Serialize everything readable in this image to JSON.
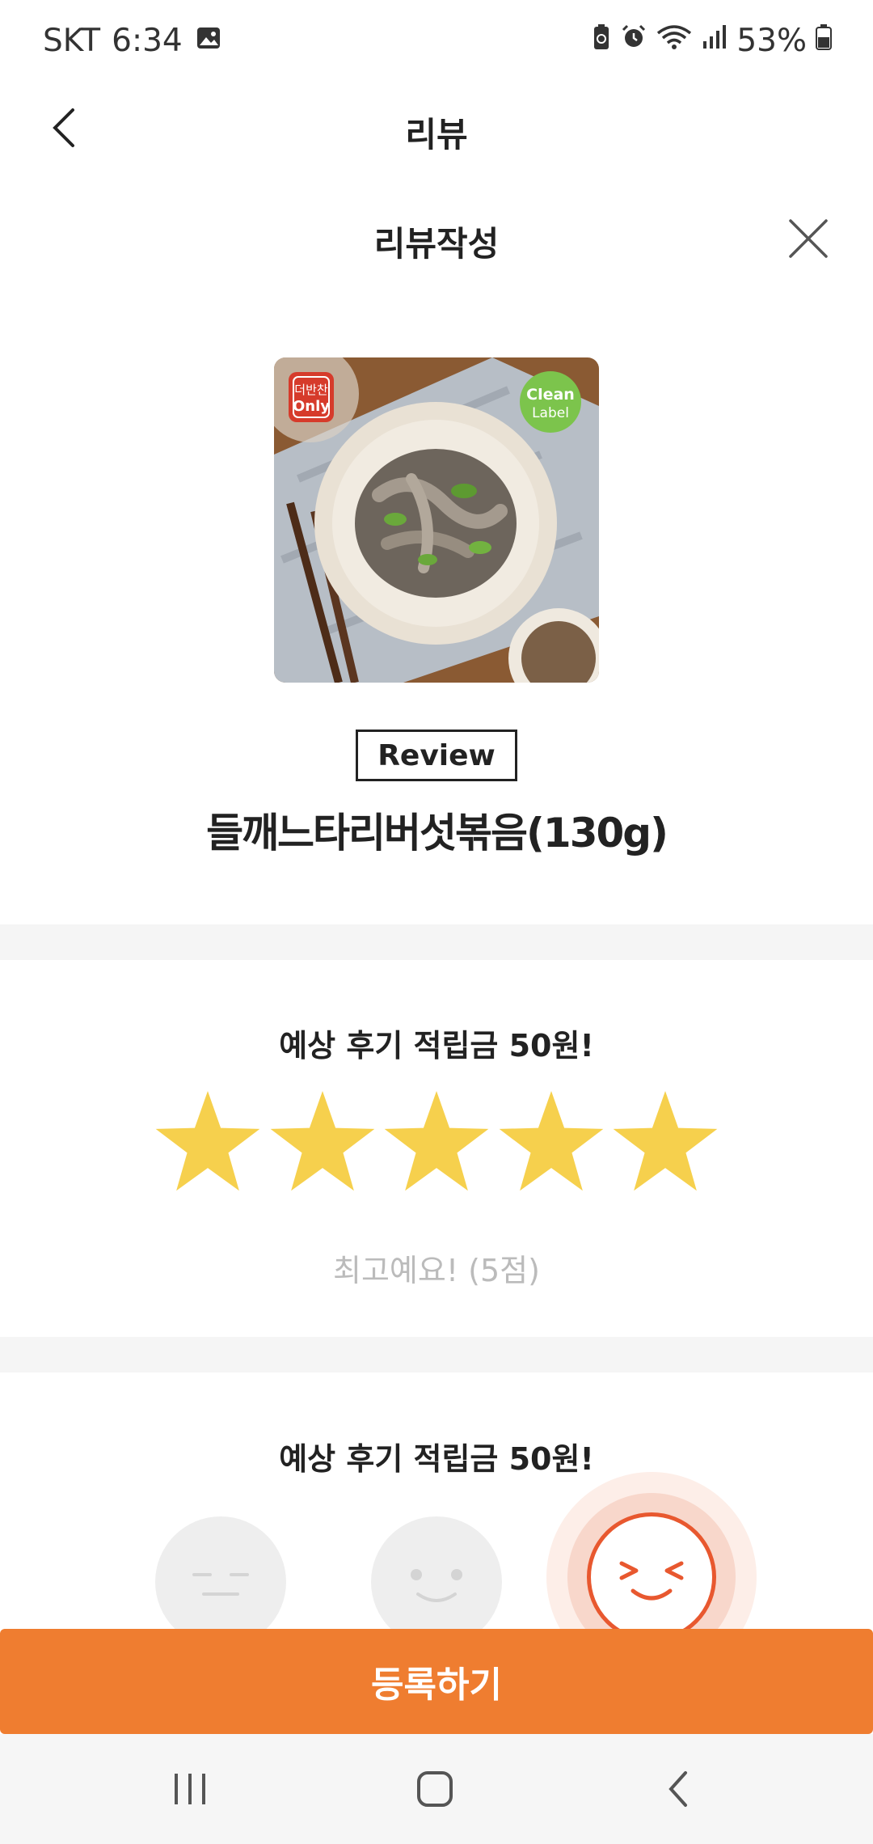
{
  "status_bar": {
    "carrier": "SKT",
    "time": "6:34",
    "battery": "53%",
    "icons": [
      "gallery-icon",
      "battery-saver-icon",
      "alarm-icon",
      "wifi-icon",
      "signal-icon",
      "battery-icon"
    ]
  },
  "header": {
    "title": "리뷰",
    "back_icon": "back-arrow-icon"
  },
  "modal": {
    "title": "리뷰작성",
    "close_icon": "close-icon"
  },
  "product": {
    "image_badge_left_1": "더반찬",
    "image_badge_left_2": "Only",
    "image_badge_right_1": "Clean",
    "image_badge_right_2": "Label",
    "review_badge": "Review",
    "name": "들깨느타리버섯볶음(130g)"
  },
  "rating_section": {
    "title": "예상 후기 적립금 50원!",
    "stars_filled": 5,
    "stars_total": 5,
    "star_color": "#f6d04d",
    "rating_text": "최고예요! (5점)"
  },
  "emoji_section": {
    "title": "예상 후기 적립금 50원!",
    "selected_index": 2,
    "accent_color": "#e8582f"
  },
  "submit": {
    "label": "등록하기",
    "color": "#ef7d30"
  },
  "nav_bar": {
    "icons": [
      "recent-apps-icon",
      "home-icon",
      "nav-back-icon"
    ]
  }
}
